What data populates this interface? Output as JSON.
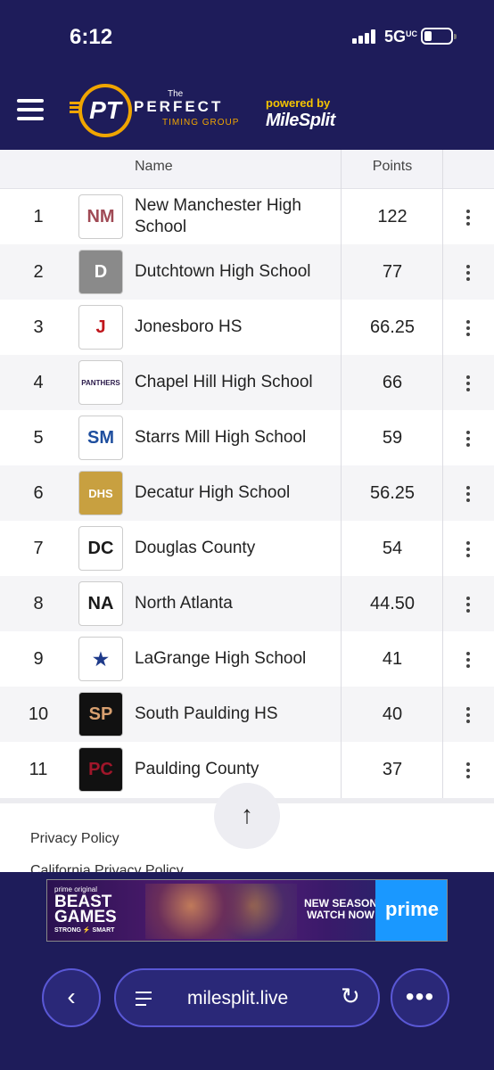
{
  "status_bar": {
    "time": "6:12",
    "network": "5G",
    "network_sup": "UC"
  },
  "header": {
    "logo_the": "The",
    "logo_initials": "PT",
    "logo_perfect": "PERFECT",
    "logo_timing": "TIMING GROUP",
    "powered_by": "powered by",
    "milesplit": "MileSplit"
  },
  "table": {
    "col_name": "Name",
    "col_points": "Points",
    "rows": [
      {
        "rank": "1",
        "team": "New Manchester High School",
        "points": "122",
        "logo_text": "NM",
        "logo_bg": "#ffffff",
        "logo_fg": "#a04a55"
      },
      {
        "rank": "2",
        "team": "Dutchtown High School",
        "points": "77",
        "logo_text": "D",
        "logo_bg": "#8a8a8a",
        "logo_fg": "#ffffff"
      },
      {
        "rank": "3",
        "team": "Jonesboro HS",
        "points": "66.25",
        "logo_text": "J",
        "logo_bg": "#ffffff",
        "logo_fg": "#c0161c"
      },
      {
        "rank": "4",
        "team": "Chapel Hill High School",
        "points": "66",
        "logo_text": "PANTHERS",
        "logo_bg": "#ffffff",
        "logo_fg": "#2a1a4a"
      },
      {
        "rank": "5",
        "team": "Starrs Mill High School",
        "points": "59",
        "logo_text": "SM",
        "logo_bg": "#ffffff",
        "logo_fg": "#1e4e9e"
      },
      {
        "rank": "6",
        "team": "Decatur High School",
        "points": "56.25",
        "logo_text": "DHS",
        "logo_bg": "#c8a040",
        "logo_fg": "#ffffff"
      },
      {
        "rank": "7",
        "team": "Douglas County",
        "points": "54",
        "logo_text": "DC",
        "logo_bg": "#ffffff",
        "logo_fg": "#1a1a1a"
      },
      {
        "rank": "8",
        "team": "North Atlanta",
        "points": "44.50",
        "logo_text": "NA",
        "logo_bg": "#ffffff",
        "logo_fg": "#1a1a1a"
      },
      {
        "rank": "9",
        "team": "LaGrange High School",
        "points": "41",
        "logo_text": "★",
        "logo_bg": "#ffffff",
        "logo_fg": "#1e3a8a"
      },
      {
        "rank": "10",
        "team": "South Paulding HS",
        "points": "40",
        "logo_text": "SP",
        "logo_bg": "#111111",
        "logo_fg": "#d8a070"
      },
      {
        "rank": "11",
        "team": "Paulding County",
        "points": "37",
        "logo_text": "PC",
        "logo_bg": "#111111",
        "logo_fg": "#a0162a"
      }
    ]
  },
  "footer": {
    "privacy": "Privacy Policy",
    "california": "California Privacy Policy",
    "scroll_top": "↑"
  },
  "ad": {
    "prime_original": "prime original",
    "beast_games": "BEAST GAMES",
    "tagline": "STRONG ⚡ SMART",
    "new_season": "NEW SEASON",
    "watch_now": "WATCH NOW",
    "prime": "prime"
  },
  "browser": {
    "back": "‹",
    "url": "milesplit.live",
    "reload": "↻",
    "more": "•••"
  }
}
